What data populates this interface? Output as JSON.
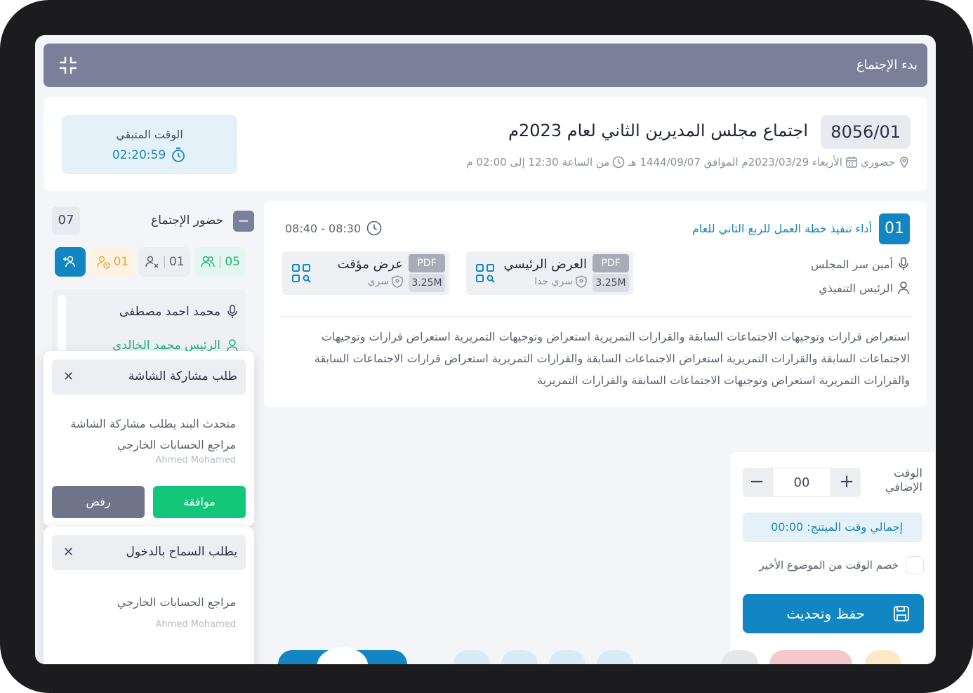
{
  "topbar": {
    "title": "بدء الإجتماع"
  },
  "meeting": {
    "id": "8056/01",
    "title": "اجتماع مجلس المديرين الثاني لعام 2023م",
    "location": "حضوري",
    "date": "الأربعاء 2023/03/29م الموافق 1444/09/07 هـ",
    "time": "من الساعة 12:30 إلى 02:00 م"
  },
  "timer": {
    "label": "الوقت المتبقي",
    "value": "02:20:59"
  },
  "attendance": {
    "title": "حضور الإجتماع",
    "count": "07",
    "present": "05",
    "absent": "01",
    "pending": "01",
    "members": [
      {
        "name": "محمد احمد مصطفى"
      },
      {
        "name": "الرئيس محمد الخالدي"
      }
    ]
  },
  "screen_share_request": {
    "title": "طلب مشاركة الشاشة",
    "message": "متحدث البند يطلب مشاركة الشاشة",
    "role": "مراجع الحسابات الخارجي",
    "person": "Ahmed Mohamed",
    "accept_label": "موافقة",
    "reject_label": "رفض"
  },
  "entry_request": {
    "title": "يطلب السماح بالدخول",
    "role": "مراجع الحسابات الخارجي",
    "person": "Ahmed Mohamed"
  },
  "agenda_item": {
    "number": "01",
    "title": "أداء تنفيذ خطة العمل للربع الثاني للعام",
    "time": "08:40 - 08:30",
    "presenter": "أمين سر المجلس",
    "owner": "الرئيس التنفيذي",
    "files": [
      {
        "name": "العرض الرئيسي",
        "level": "سري جدا",
        "type": "PDF",
        "size": "3.25M"
      },
      {
        "name": "عرض مؤقت",
        "level": "سري",
        "type": "PDF",
        "size": "3.25M"
      }
    ],
    "description": "استعراض قرارات وتوجيهات الاجتماعات السابقة والقرارات التمريرية استعراض وتوجيهات التمريرية استعراض قرارات وتوجيهات الاجتماعات السابقة والقرارات التمريرية استعراض الاجتماعات السابقة والقرارات التمريرية استعراض قرارات الاجتماعات السابقة والقرارات التمريرية استعراض وتوجيهات الاجتماعات السابقة والقرارات التمريرية"
  },
  "extra_time": {
    "label": "الوقت الإضافي",
    "value": "00",
    "total_label": "إجمالي وقت الميتنج: 00:00",
    "deduct_label": "خصم الوقت من الموضوع الأخير",
    "save_label": "حفظ وتحديث"
  },
  "colors": {
    "primary": "#1186c2",
    "success": "#12c77a",
    "header": "#7a8099"
  }
}
